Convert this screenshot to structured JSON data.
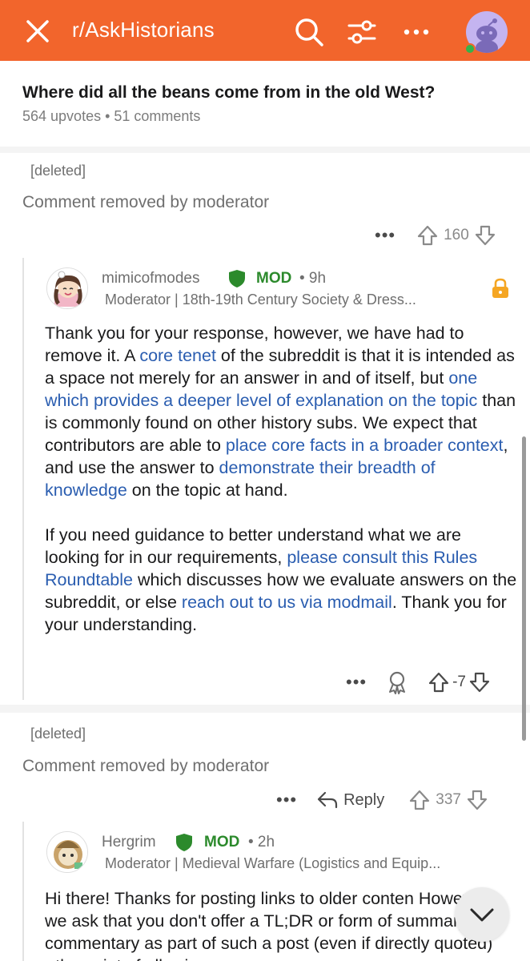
{
  "header": {
    "subreddit": "r/AskHistorians",
    "icons": [
      "close-icon",
      "search-icon",
      "filters-icon",
      "more-icon",
      "avatar"
    ],
    "brand_color": "#f2652c"
  },
  "post": {
    "title": "Where did all the beans come from in the old West?",
    "meta": "564 upvotes • 51 comments"
  },
  "comments": [
    {
      "author": "[deleted]",
      "body": "Comment removed by moderator",
      "score": "160",
      "reply": {
        "author": "mimicofmodes",
        "badge": "MOD",
        "time": "• 9h",
        "flair": "Moderator | 18th-19th Century Society & Dress...",
        "body_parts": {
          "p1_a": "Thank you for your response, however, we have had to remove it. A ",
          "p1_link1": "core tenet",
          "p1_b": " of the subreddit is that it is intended as a space not merely for an answer in and of itself, but ",
          "p1_link2": "one which provides a deeper level of explanation on the topic",
          "p1_c": " than is commonly found on other history subs. We expect that contributors are able to ",
          "p1_link3": "place core facts in a broader context",
          "p1_d": ", and use the answer to ",
          "p1_link4": "demonstrate their breadth of knowledge",
          "p1_e": " on the topic at hand.",
          "p2_a": "If you need guidance to better understand what we are looking for in our requirements, ",
          "p2_link1": "please consult this Rules Roundtable",
          "p2_b": " which discusses how we evaluate answers on the subreddit, or else ",
          "p2_link2": "reach out to us via modmail",
          "p2_c": ". Thank you for your understanding."
        },
        "score": "-7"
      }
    },
    {
      "author": "[deleted]",
      "body": "Comment removed by moderator",
      "reply_label": "Reply",
      "score": "337",
      "reply": {
        "author": "Hergrim",
        "badge": "MOD",
        "time": "• 2h",
        "flair": "Moderator | Medieval Warfare (Logistics and Equip...",
        "body": "Hi there! Thanks for posting links to older conten However, we ask that you don't offer a TL;DR or form of summary or commentary as part of such a post (even if directly quoted) - the point of allowi"
      }
    }
  ]
}
